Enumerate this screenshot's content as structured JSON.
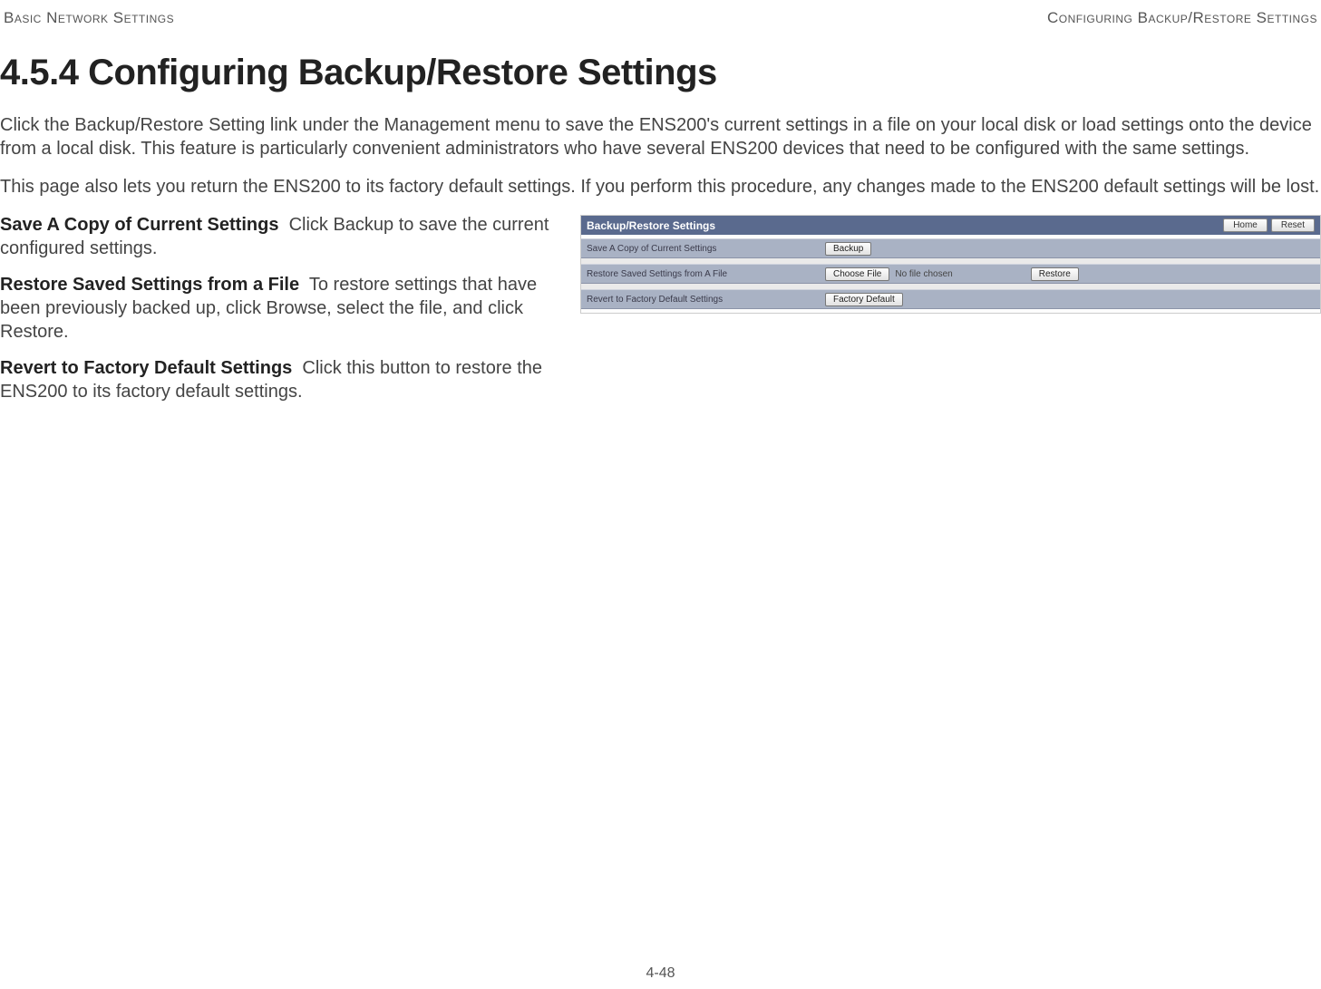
{
  "header": {
    "left": "Basic Network Settings",
    "right": "Configuring Backup/Restore Settings"
  },
  "section_heading": "4.5.4 Configuring Backup/Restore Settings",
  "paragraphs": {
    "p1": "Click the Backup/Restore Setting link under the Management menu to save the ENS200's current settings in a file on your local disk or load settings onto the device from a local disk. This feature is particularly convenient administrators who have several ENS200 devices that need to be configured with the same settings.",
    "p2": "This page also lets you return the ENS200 to its factory default settings. If you perform this procedure, any changes made to the ENS200 default settings will be lost."
  },
  "definitions": [
    {
      "term": "Save A Copy of Current Settings",
      "desc": "Click Backup to save the current configured settings."
    },
    {
      "term": "Restore Saved Settings from a File",
      "desc": "To restore settings that have been previously backed up, click Browse, select the file, and click Restore."
    },
    {
      "term": "Revert to Factory Default Settings",
      "desc": "Click this button to restore the ENS200 to its factory default settings."
    }
  ],
  "panel": {
    "title": "Backup/Restore Settings",
    "home_btn": "Home",
    "reset_btn": "Reset",
    "rows": {
      "save": {
        "label": "Save A Copy of Current Settings",
        "button": "Backup"
      },
      "restore": {
        "label": "Restore Saved Settings from A File",
        "choose_btn": "Choose File",
        "file_status": "No file chosen",
        "restore_btn": "Restore"
      },
      "revert": {
        "label": "Revert to Factory Default Settings",
        "button": "Factory Default"
      }
    }
  },
  "page_number": "4-48"
}
